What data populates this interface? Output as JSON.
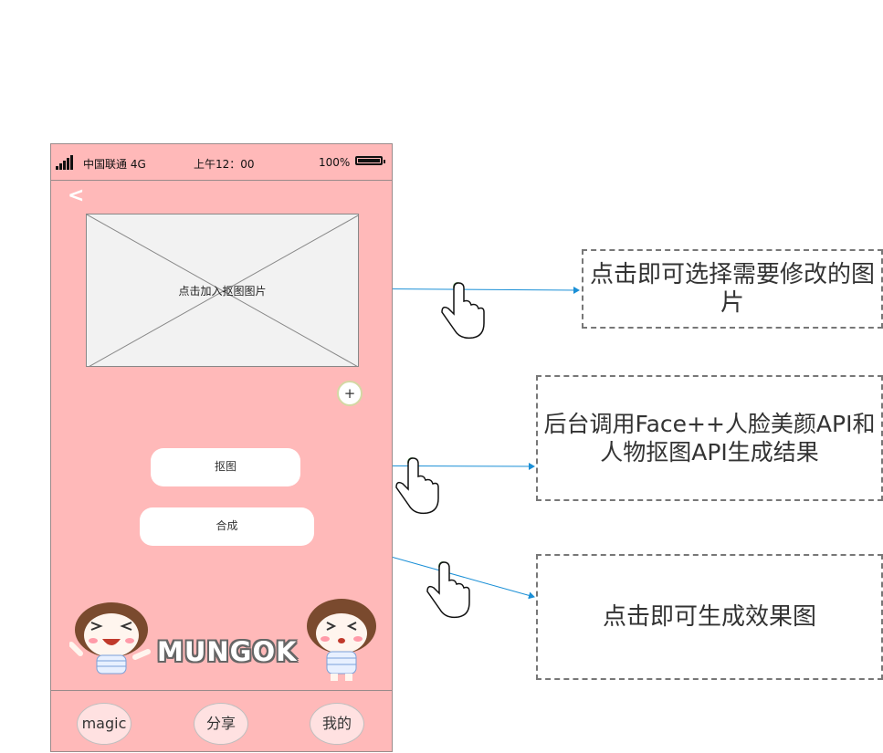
{
  "status_bar": {
    "carrier": "中国联通 4G",
    "time": "上午12：00",
    "battery": "100%"
  },
  "header": {
    "back_label": "<"
  },
  "image_picker": {
    "placeholder_label": "点击加入抠图图片",
    "add_label": "+"
  },
  "actions": {
    "cutout_label": "抠图",
    "compose_label": "合成"
  },
  "brand": {
    "logo_text": "MUNGOK"
  },
  "tabbar": {
    "magic_label": "magic",
    "share_label": "分享",
    "mine_label": "我的"
  },
  "annotations": {
    "select_image": "点击即可选择需要修改的图片",
    "backend_call": "后台调用Face++人脸美颜API和人物抠图API生成结果",
    "generate_result": "点击即可生成效果图"
  },
  "icons": {
    "connector_color": "#1a8fd6",
    "hand_dot_color": "#7fc47f",
    "phone_bg": "#ffb9b9"
  }
}
